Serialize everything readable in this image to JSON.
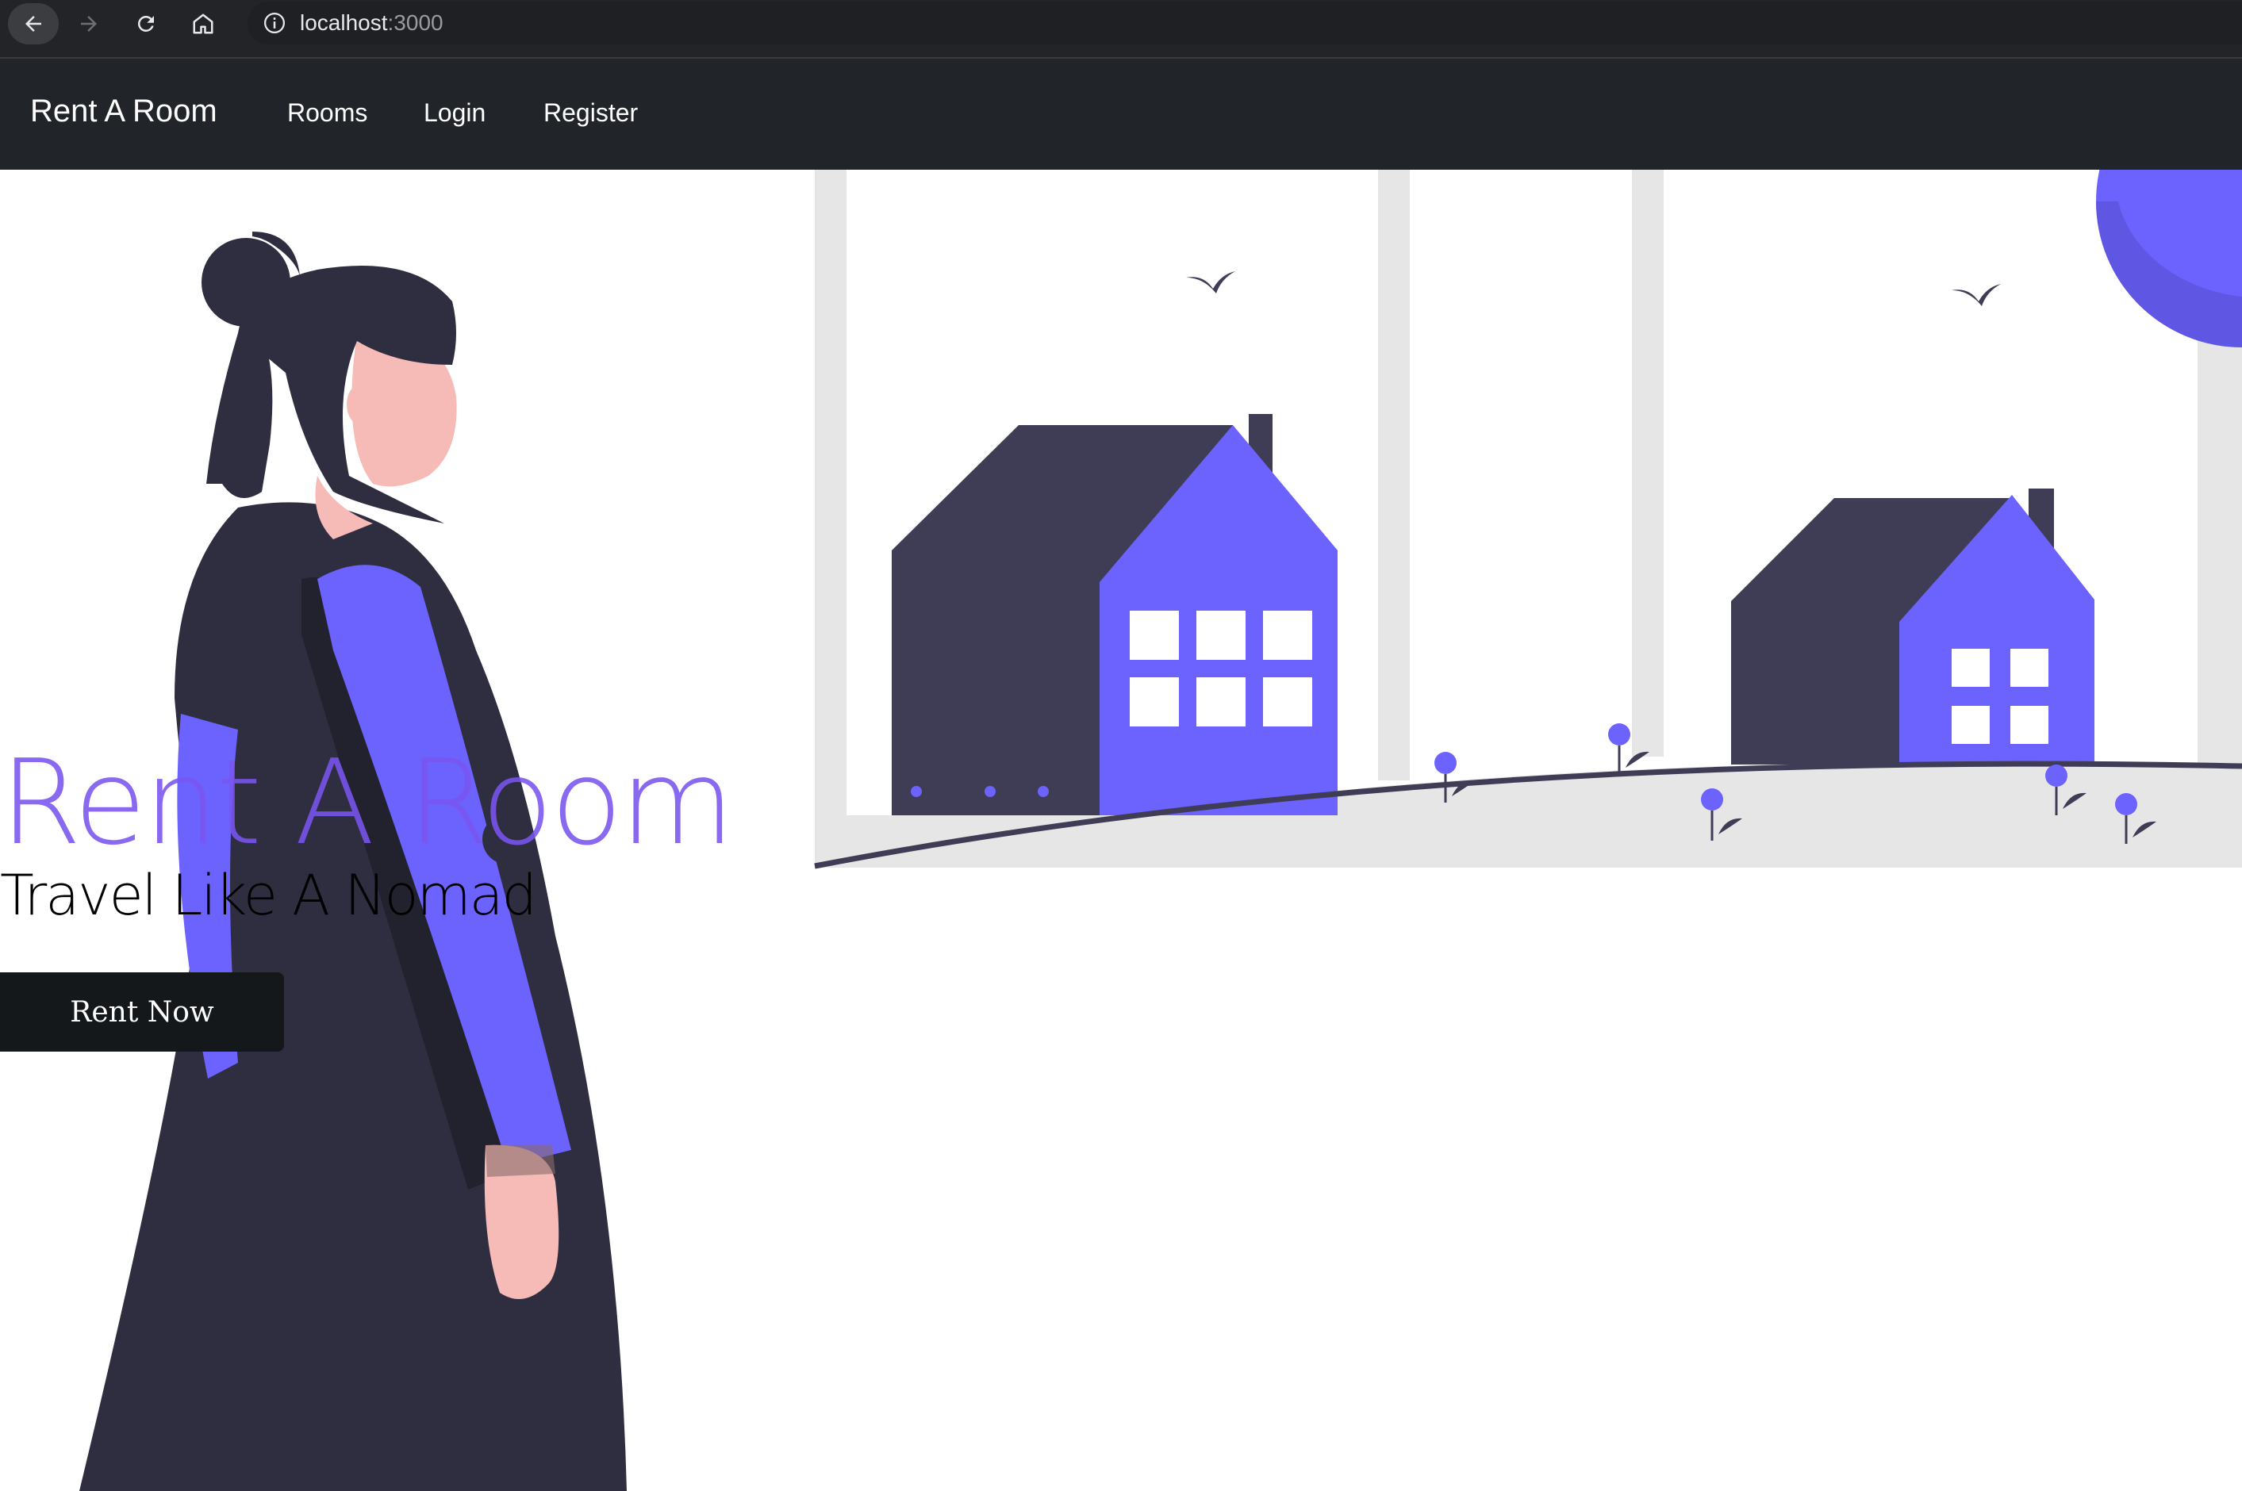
{
  "browser": {
    "url_host": "localhost",
    "url_port": ":3000",
    "icons": {
      "back": "arrow-left-icon",
      "forward": "arrow-right-icon",
      "reload": "reload-icon",
      "home": "home-icon",
      "info": "info-icon"
    }
  },
  "navbar": {
    "brand": "Rent A Room",
    "links": [
      {
        "label": "Rooms"
      },
      {
        "label": "Login"
      },
      {
        "label": "Register"
      }
    ]
  },
  "hero": {
    "title": "Rent A Room",
    "subtitle": "Travel Like A Nomad",
    "cta_label": "Rent Now"
  },
  "colors": {
    "accent_purple": "#6c63ff",
    "title_purple": "#7a55f0",
    "dark_figure": "#2f2e41",
    "house_dark": "#3f3d56",
    "skin": "#f6bbb7",
    "ground": "#e6e6e6",
    "navbar_bg": "#212429"
  }
}
